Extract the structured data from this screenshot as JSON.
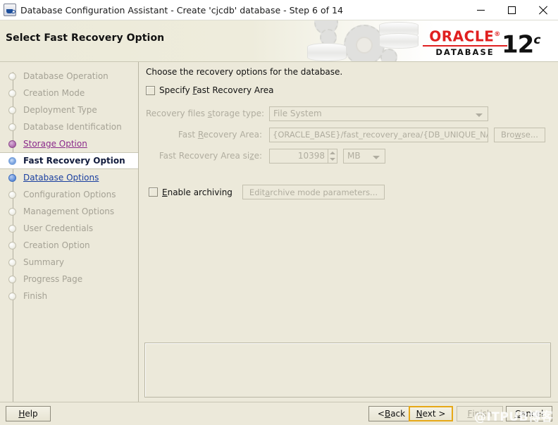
{
  "window": {
    "title": "Database Configuration Assistant - Create 'cjcdb' database - Step 6 of 14",
    "icon": "java-app-icon",
    "minimize_label": "Minimize",
    "maximize_label": "Maximize",
    "close_label": "Close"
  },
  "banner": {
    "title": "Select Fast Recovery Option",
    "logo_word": "ORACLE",
    "logo_trademark": "®",
    "logo_product": "DATABASE",
    "logo_version": "12",
    "logo_version_suffix": "c",
    "brand_red": "#e02020"
  },
  "sidebar": {
    "items": [
      {
        "label": "Database Operation",
        "state": "pending"
      },
      {
        "label": "Creation Mode",
        "state": "pending"
      },
      {
        "label": "Deployment Type",
        "state": "pending"
      },
      {
        "label": "Database Identification",
        "state": "pending"
      },
      {
        "label": "Storage Option",
        "state": "visited"
      },
      {
        "label": "Fast Recovery Option",
        "state": "current"
      },
      {
        "label": "Database Options",
        "state": "link"
      },
      {
        "label": "Configuration Options",
        "state": "pending"
      },
      {
        "label": "Management Options",
        "state": "pending"
      },
      {
        "label": "User Credentials",
        "state": "pending"
      },
      {
        "label": "Creation Option",
        "state": "pending"
      },
      {
        "label": "Summary",
        "state": "pending"
      },
      {
        "label": "Progress Page",
        "state": "pending"
      },
      {
        "label": "Finish",
        "state": "pending"
      }
    ]
  },
  "main": {
    "intro": "Choose the recovery options for the database.",
    "specify_fra": {
      "label_before": "Specify ",
      "mnemonic": "F",
      "label_after": "ast Recovery Area",
      "checked": false
    },
    "storage_type": {
      "label_before": "Recovery files ",
      "mnemonic": "s",
      "label_after": "torage type:",
      "value": "File System",
      "enabled": false
    },
    "fra_path": {
      "label_before": "Fast ",
      "mnemonic": "R",
      "label_after": "ecovery Area:",
      "value": "{ORACLE_BASE}/fast_recovery_area/{DB_UNIQUE_NAME}",
      "enabled": false
    },
    "browse": {
      "label_before": "Bro",
      "mnemonic": "w",
      "label_after": "se...",
      "enabled": false
    },
    "fra_size": {
      "label_before": "Fast Recovery Area si",
      "mnemonic": "z",
      "label_after": "e:",
      "value": "10398",
      "units": "MB",
      "enabled": false
    },
    "enable_archiving": {
      "label_before": "",
      "mnemonic": "E",
      "label_after": "nable archiving",
      "checked": false
    },
    "edit_archive": {
      "label_before": "Edit ",
      "mnemonic": "a",
      "label_after": "rchive mode parameters...",
      "enabled": false
    }
  },
  "footer": {
    "help": {
      "before": "",
      "mnemonic": "H",
      "after": "elp",
      "enabled": true,
      "focused": false
    },
    "back": {
      "before": "< ",
      "mnemonic": "B",
      "after": "ack",
      "enabled": true,
      "focused": false
    },
    "next": {
      "before": "",
      "mnemonic": "N",
      "after": "ext >",
      "enabled": true,
      "focused": true
    },
    "finish": {
      "before": "",
      "mnemonic": "F",
      "after": "inish",
      "enabled": false,
      "focused": false
    },
    "cancel": {
      "before": "",
      "mnemonic": "C",
      "after": "ancel",
      "enabled": false,
      "focused": false
    }
  },
  "watermark": {
    "text": "@ITPUB博客"
  }
}
